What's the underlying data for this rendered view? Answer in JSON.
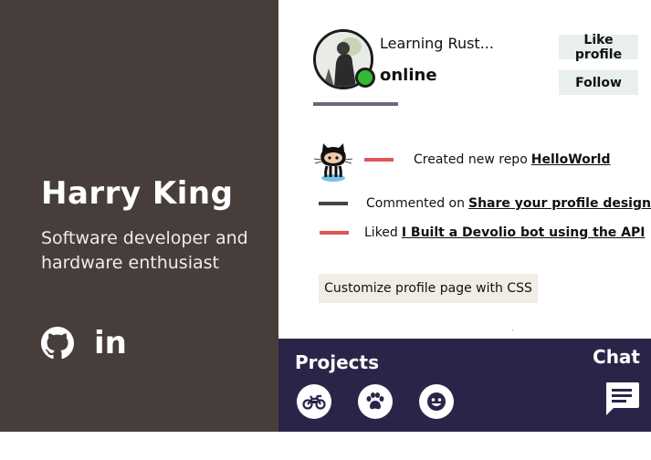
{
  "profile": {
    "name": "Harry King",
    "tagline": "Software developer and hardware enthusiast",
    "status_message": "Learning Rust...",
    "presence": "online",
    "socials": [
      {
        "icon": "github-icon"
      },
      {
        "icon": "linkedin-icon",
        "text": "in"
      }
    ]
  },
  "actions": {
    "like_label": "Like profile",
    "follow_label": "Follow",
    "customize_label": "Customize profile page with CSS"
  },
  "activity": [
    {
      "prefix": "Created new repo",
      "link": "HelloWorld",
      "dash_color": "#e05555"
    },
    {
      "prefix": "Commented on",
      "link": "Share your profile design!",
      "dash_color": "#444444"
    },
    {
      "prefix": "Liked",
      "link": "I Built a Devolio bot using the API",
      "dash_color": "#e05555"
    }
  ],
  "projects": {
    "title": "Projects",
    "items": [
      {
        "icon": "motorcycle-icon"
      },
      {
        "icon": "paw-icon"
      },
      {
        "icon": "face-icon"
      }
    ]
  },
  "chat": {
    "label": "Chat",
    "icon": "chat-bubble-icon"
  },
  "colors": {
    "left_panel": "#473e3b",
    "projects_bar": "#2a2548",
    "online_green": "#33bb33",
    "accent_red": "#e05555"
  }
}
